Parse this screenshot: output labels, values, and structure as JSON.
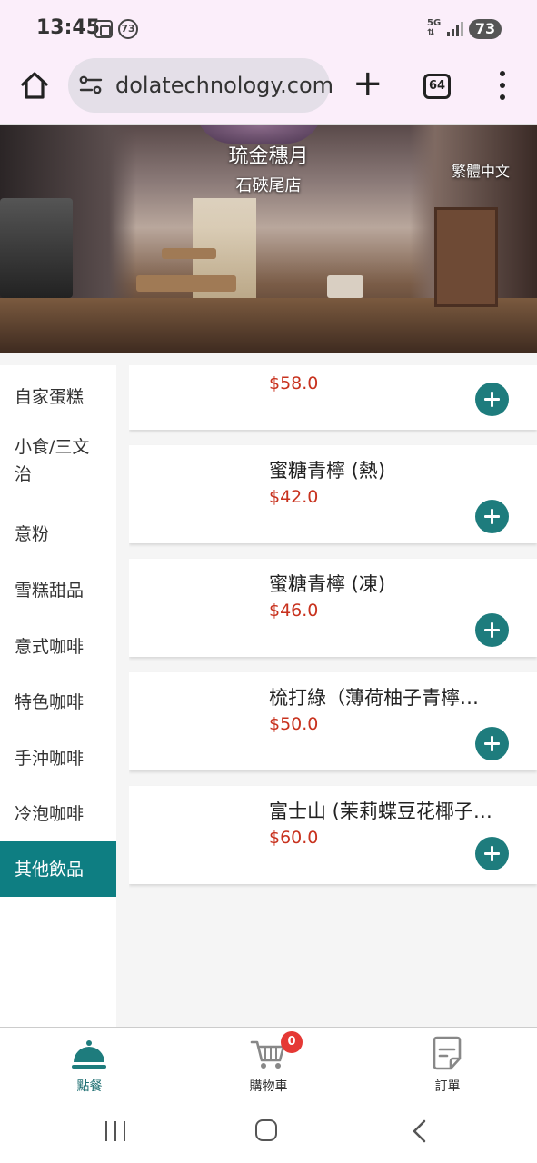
{
  "status_bar": {
    "time": "13:45",
    "notification_count": "73",
    "network": "5G",
    "battery": "73"
  },
  "browser": {
    "url": "dolatechnology.com",
    "tab_count": "64",
    "icons": [
      "home-icon",
      "site-settings-icon",
      "new-tab-icon",
      "tab-switcher-icon",
      "more-vert-icon"
    ]
  },
  "header": {
    "store_name": "琉金穗月",
    "branch_name": "石硤尾店",
    "language": "繁體中文"
  },
  "categories": [
    {
      "label": "自家蛋糕",
      "active": false
    },
    {
      "label": "小食/三文治",
      "active": false
    },
    {
      "label": "意粉",
      "active": false
    },
    {
      "label": "雪糕甜品",
      "active": false
    },
    {
      "label": "意式咖啡",
      "active": false
    },
    {
      "label": "特色咖啡",
      "active": false
    },
    {
      "label": "手沖咖啡",
      "active": false
    },
    {
      "label": "冷泡咖啡",
      "active": false
    },
    {
      "label": "其他飲品",
      "active": true
    }
  ],
  "products": [
    {
      "name": "",
      "price": "$58.0"
    },
    {
      "name": "蜜糖青檸 (熱)",
      "price": "$42.0"
    },
    {
      "name": "蜜糖青檸 (凍)",
      "price": "$46.0"
    },
    {
      "name": "梳打綠（薄荷柚子青檸…",
      "price": "$50.0"
    },
    {
      "name": "富士山 (茉莉蝶豆花椰子…",
      "price": "$60.0"
    }
  ],
  "bottom_nav": {
    "items": [
      {
        "label": "點餐",
        "icon": "cloche-icon",
        "active": true
      },
      {
        "label": "購物車",
        "icon": "cart-icon",
        "active": false
      },
      {
        "label": "訂單",
        "icon": "orders-icon",
        "active": false
      }
    ],
    "cart_count": "0"
  },
  "colors": {
    "accent": "#0e7e82",
    "price": "#c8321e",
    "badge": "#e53935"
  }
}
